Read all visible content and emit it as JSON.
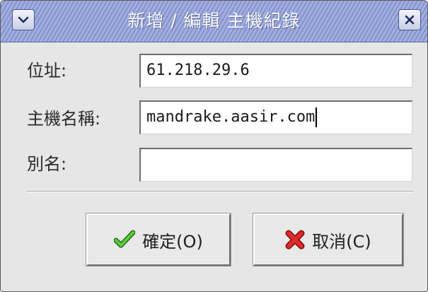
{
  "window": {
    "title": "新增 / 編輯 主機紀錄"
  },
  "form": {
    "address_label": "位址:",
    "address_value": "61.218.29.6",
    "hostname_label": "主機名稱:",
    "hostname_value": "mandrake.aasir.com",
    "alias_label": "別名:",
    "alias_value": ""
  },
  "buttons": {
    "ok_label": "確定(O)",
    "cancel_label": "取消(C)"
  },
  "icons": {
    "window_menu": "chevron-down-icon",
    "window_close": "close-icon",
    "ok": "checkmark-icon",
    "cancel": "red-x-icon"
  },
  "colors": {
    "titlebar": "#8c9ad0",
    "ok_icon": "#3aa12a",
    "cancel_icon": "#d42020"
  }
}
